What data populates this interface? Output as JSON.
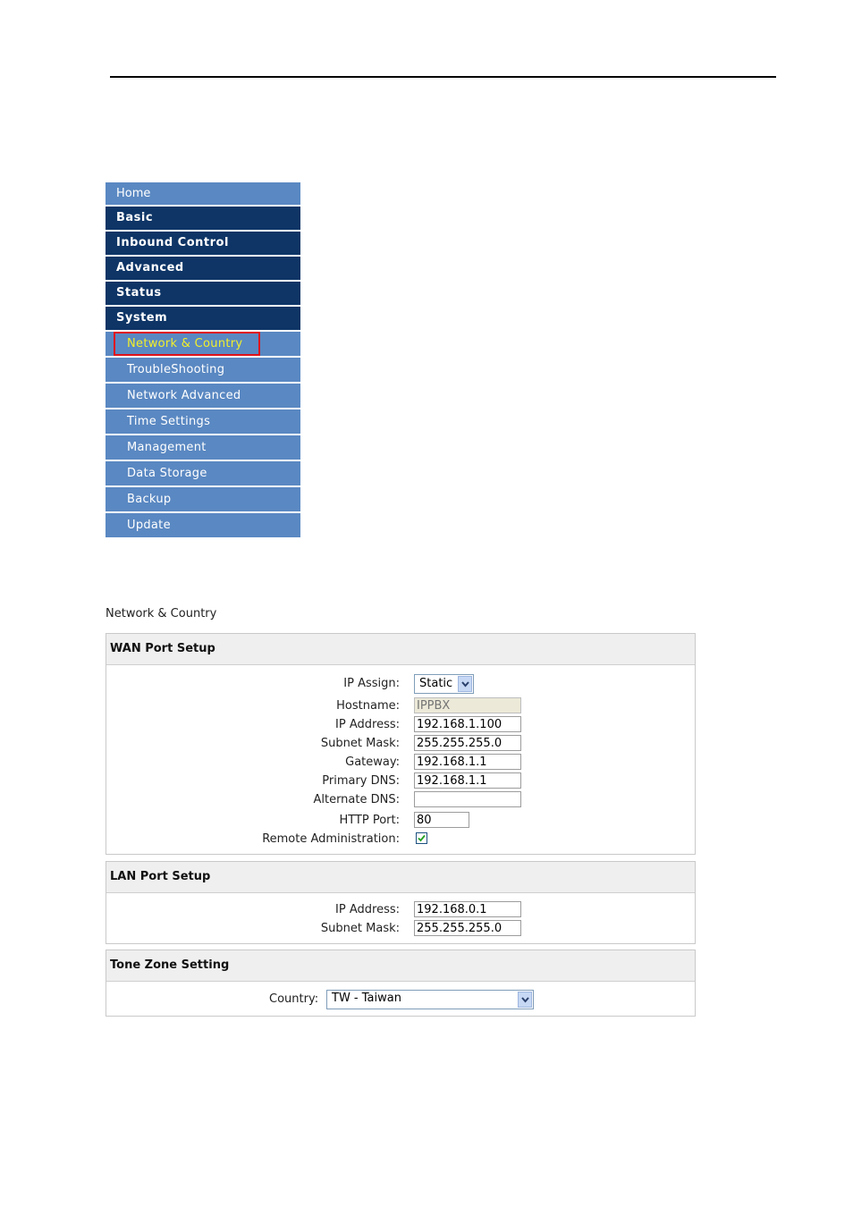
{
  "menu": {
    "home": "Home",
    "basic": "Basic",
    "inbound": "Inbound Control",
    "advanced": "Advanced",
    "status": "Status",
    "system": "System",
    "sub": [
      "Network & Country",
      "TroubleShooting",
      "Network Advanced",
      "Time Settings",
      "Management",
      "Data Storage",
      "Backup",
      "Update"
    ]
  },
  "page_title": "Network & Country",
  "wan": {
    "heading": "WAN Port Setup",
    "ip_assign_label": "IP Assign:",
    "ip_assign_value": "Static",
    "hostname_label": "Hostname:",
    "hostname_placeholder": "IPPBX",
    "ip_label": "IP Address:",
    "ip_value": "192.168.1.100",
    "mask_label": "Subnet Mask:",
    "mask_value": "255.255.255.0",
    "gw_label": "Gateway:",
    "gw_value": "192.168.1.1",
    "dns1_label": "Primary DNS:",
    "dns1_value": "192.168.1.1",
    "dns2_label": "Alternate DNS:",
    "dns2_value": "",
    "http_label": "HTTP Port:",
    "http_value": "80",
    "remote_label": "Remote Administration:",
    "remote_checked": true
  },
  "lan": {
    "heading": "LAN Port Setup",
    "ip_label": "IP Address:",
    "ip_value": "192.168.0.1",
    "mask_label": "Subnet Mask:",
    "mask_value": "255.255.255.0"
  },
  "tone": {
    "heading": "Tone Zone Setting",
    "country_label": "Country:",
    "country_value": "TW - Taiwan"
  },
  "colors": {
    "menu_dark": "#0e3566",
    "menu_light": "#5a88c2",
    "active_text": "#f2ef2a",
    "highlight_box": "#e0131a"
  }
}
